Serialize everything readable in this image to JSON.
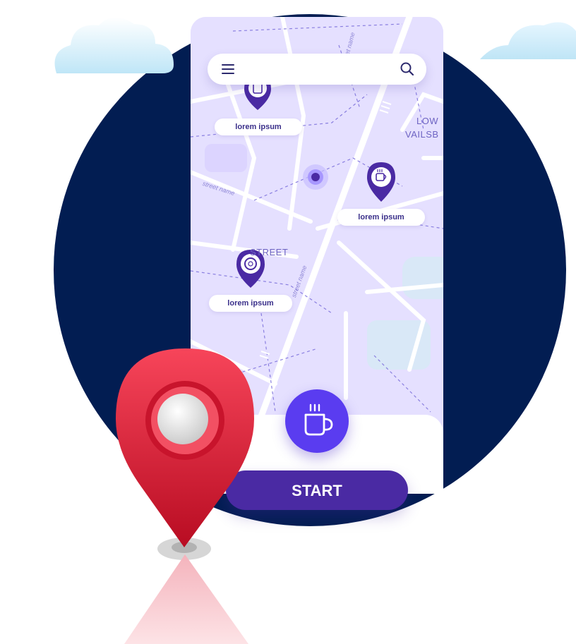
{
  "colors": {
    "background_circle": "#021d52",
    "map_background": "#e5e0ff",
    "accent_purple": "#5a3cf0",
    "button_dark_purple": "#4a2aa3",
    "pin_red": "#e8283f"
  },
  "header": {
    "menu_icon": "hamburger-menu-icon",
    "search_icon": "search-icon"
  },
  "map": {
    "street_labels": [
      "LOW",
      "VAILSB",
      "STREET"
    ],
    "small_street_labels": [
      "street name",
      "street name",
      "street name"
    ],
    "places": [
      {
        "label": "lorem ipsum",
        "icon": "clipboard-icon"
      },
      {
        "label": "lorem ipsum",
        "icon": "coffee-icon"
      },
      {
        "label": "lorem ipsum",
        "icon": "donut-icon"
      }
    ],
    "current_location_icon": "location-dot-icon"
  },
  "actions": {
    "coffee_icon": "coffee-mug-icon",
    "start_label": "START"
  },
  "decorations": {
    "big_pin_icon": "map-pin-icon",
    "clouds": [
      "cloud-icon",
      "cloud-icon"
    ]
  }
}
